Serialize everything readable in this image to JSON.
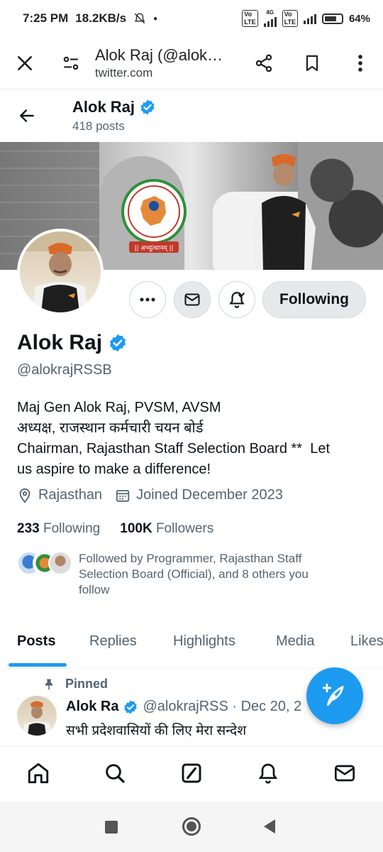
{
  "status_bar": {
    "time": "7:25 PM",
    "data_rate": "18.2KB/s",
    "battery": "64%",
    "network": "4G"
  },
  "browser": {
    "title": "Alok Raj (@alok…",
    "domain": "twitter.com",
    "icons": [
      "close-icon",
      "site-settings-icon",
      "share-icon",
      "bookmark-icon",
      "more-vertical-icon"
    ]
  },
  "header": {
    "name": "Alok Raj",
    "posts": "418 posts"
  },
  "banner": {
    "emblem_caption": "|| अभ्युत्थानम् ||"
  },
  "profile": {
    "name": "Alok Raj",
    "handle": "@alokrajRSSB",
    "bio_lines": [
      "Maj Gen Alok Raj, PVSM, AVSM",
      "अध्यक्ष, राजस्थान कर्मचारी चयन बोर्ड",
      "Chairman, Rajasthan Staff Selection Board **  Let",
      "us aspire to make a difference!"
    ],
    "location": "Rajasthan",
    "joined": "Joined December 2023",
    "following_count": "233",
    "following_label": "Following",
    "followers_count": "100K",
    "followers_label": "Followers",
    "followed_by_lines": [
      "Followed by Programmer, Rajasthan Staff",
      "Selection Board (Official), and 8 others you",
      "follow"
    ],
    "follow_button": "Following"
  },
  "tabs": [
    "Posts",
    "Replies",
    "Highlights",
    "Media",
    "Likes"
  ],
  "pinned_tweet": {
    "pinned_label": "Pinned",
    "name": "Alok Ra",
    "handle_date": "@alokrajRSS · Dec 20, 2",
    "text": "सभी प्रदेशवासियों की लिए मेरा सन्देश"
  },
  "colors": {
    "accent": "#1d9bf0",
    "text_primary": "#0f1419",
    "text_secondary": "#536471",
    "verified": "#1d9bf0"
  }
}
